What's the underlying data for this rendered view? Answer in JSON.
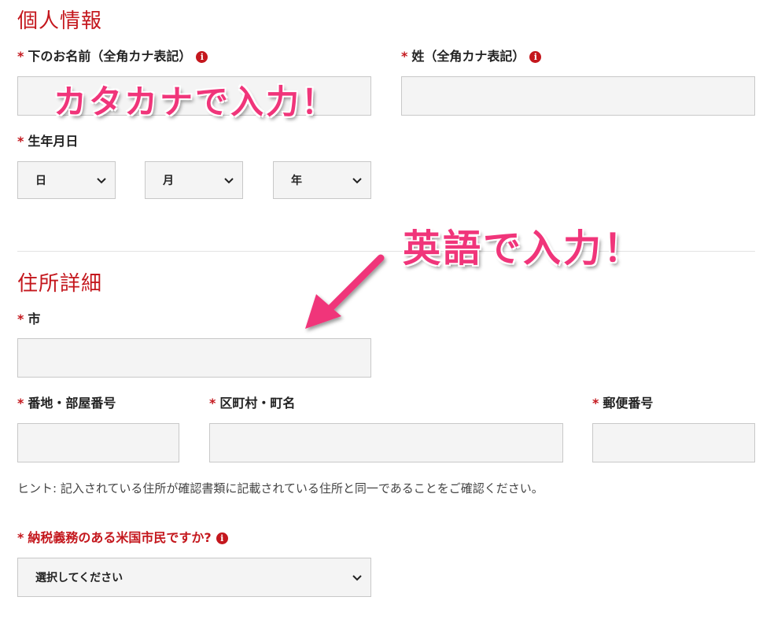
{
  "personal": {
    "title": "個人情報",
    "first_name_label": "下のお名前（全角カナ表記）",
    "last_name_label": "姓（全角カナ表記）",
    "dob_label": "生年月日",
    "day_value": "日",
    "month_value": "月",
    "year_value": "年"
  },
  "address": {
    "title": "住所詳細",
    "city_label": "市",
    "street_label": "番地・部屋番号",
    "district_label": "区町村・町名",
    "zip_label": "郵便番号",
    "hint": "ヒント: 記入されている住所が確認書類に記載されている住所と同一であることをご確認ください。"
  },
  "tax": {
    "question_label": "納税義務のある米国市民ですか?",
    "select_value": "選択してください"
  },
  "annotations": {
    "katakana": "カタカナで入力！",
    "english": "英語で入力！"
  },
  "common": {
    "required_mark": "*",
    "info_icon_glyph": "i"
  },
  "colors": {
    "brand_red": "#c4171d",
    "annotation_pink": "#f0357a",
    "field_bg": "#f4f4f4",
    "field_border": "#c8c8c8"
  }
}
